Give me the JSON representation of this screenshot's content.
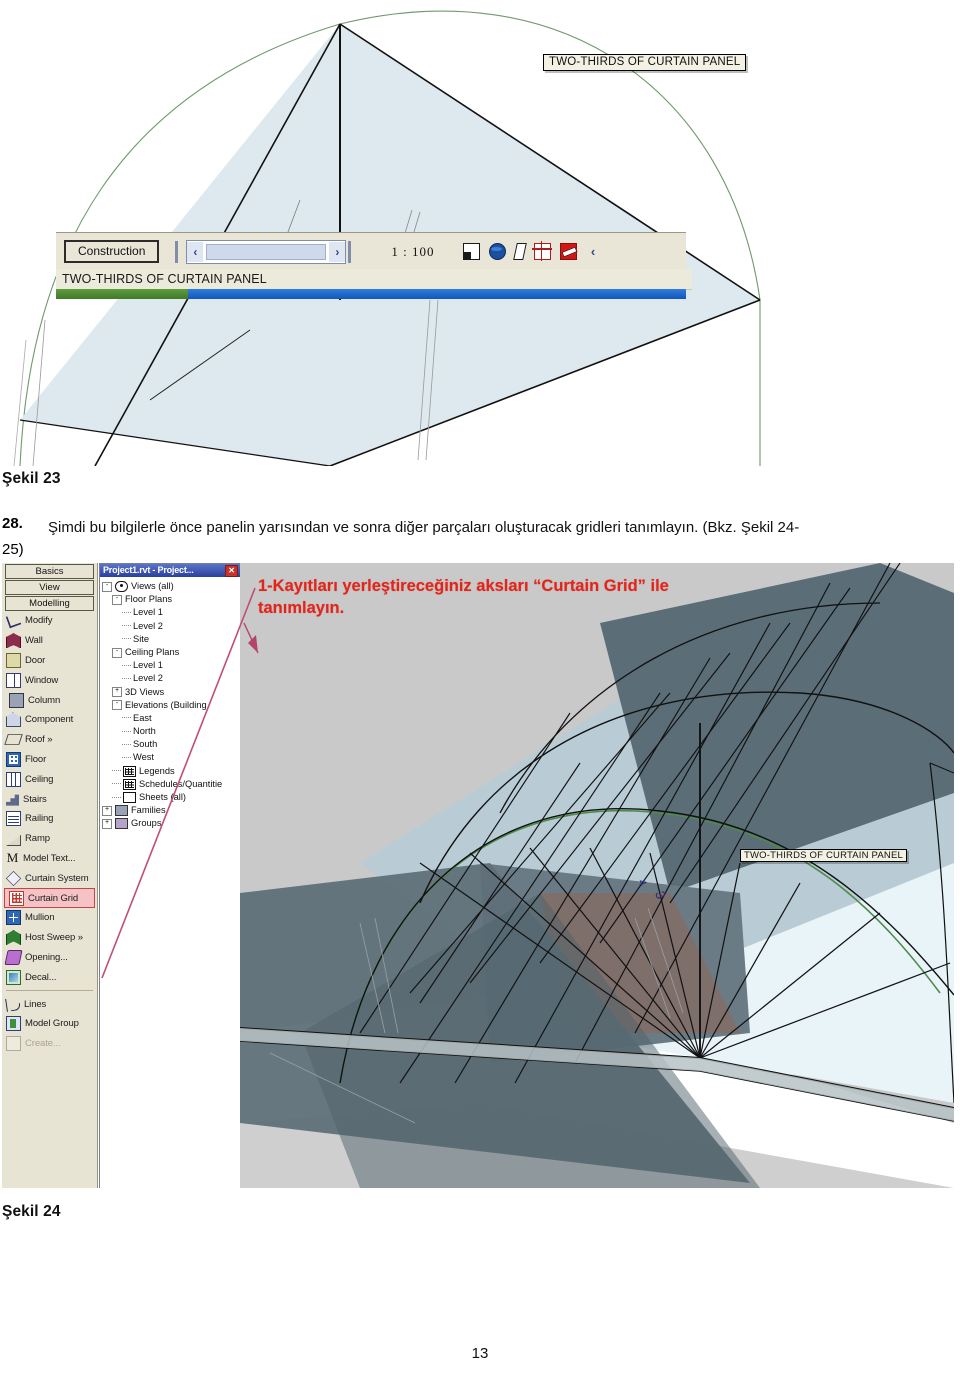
{
  "document": {
    "page_number": "13",
    "figure_23_caption": "Şekil 23",
    "figure_24_caption": "Şekil 24",
    "step": {
      "number": "28.",
      "text": "Şimdi bu bilgilerle önce panelin yarısından ve sonra diğer parçaları oluşturacak gridleri tanımlayın. (Bkz. Şekil 24-",
      "continuation": "25)"
    }
  },
  "figure23": {
    "panel_label": "TWO-THIRDS OF CURTAIN PANEL",
    "statusbar": {
      "phase_button": "Construction",
      "scale": "1 : 100",
      "prev_arrow": "‹",
      "next_arrow": "›",
      "icons": [
        {
          "name": "shadows-icon",
          "glyph": "shadow"
        },
        {
          "name": "render-globe-icon",
          "glyph": "globe"
        },
        {
          "name": "shading-icon",
          "glyph": "para"
        },
        {
          "name": "crop-region-icon",
          "glyph": "crop"
        },
        {
          "name": "hide-crop-icon",
          "glyph": "hide"
        },
        {
          "name": "collapse-left-icon",
          "glyph": "left"
        }
      ]
    },
    "view_name": "TWO-THIRDS OF CURTAIN PANEL"
  },
  "figure24": {
    "annotation": "1-Kayıtları yerleştireceğiniz aksları “Curtain Grid” ile tanımlayın.",
    "panel_label": "TWO-THIRDS OF CURTAIN PANEL",
    "designbar": {
      "tabs": [
        "Basics",
        "View",
        "Modelling"
      ],
      "tools": [
        {
          "label": "Modify",
          "icon": "modify-arrow-icon",
          "glyph": "g-modify",
          "selected": false,
          "disabled": false
        },
        {
          "label": "Wall",
          "icon": "wall-icon",
          "glyph": "g-wall",
          "selected": false,
          "disabled": false
        },
        {
          "label": "Door",
          "icon": "door-icon",
          "glyph": "g-door",
          "selected": false,
          "disabled": false
        },
        {
          "label": "Window",
          "icon": "window-icon",
          "glyph": "g-window",
          "selected": false,
          "disabled": false
        },
        {
          "label": "Column",
          "icon": "column-icon",
          "glyph": "g-column",
          "selected": false,
          "disabled": false
        },
        {
          "label": "Component",
          "icon": "component-icon",
          "glyph": "g-component",
          "selected": false,
          "disabled": false
        },
        {
          "label": "Roof »",
          "icon": "roof-icon",
          "glyph": "g-roof",
          "selected": false,
          "disabled": false
        },
        {
          "label": "Floor",
          "icon": "floor-icon",
          "glyph": "g-floor",
          "selected": false,
          "disabled": false
        },
        {
          "label": "Ceiling",
          "icon": "ceiling-icon",
          "glyph": "g-ceiling",
          "selected": false,
          "disabled": false
        },
        {
          "label": "Stairs",
          "icon": "stairs-icon",
          "glyph": "g-stairs",
          "selected": false,
          "disabled": false
        },
        {
          "label": "Railing",
          "icon": "railing-icon",
          "glyph": "g-railing",
          "selected": false,
          "disabled": false
        },
        {
          "label": "Ramp",
          "icon": "ramp-icon",
          "glyph": "g-ramp",
          "selected": false,
          "disabled": false
        },
        {
          "label": "Model Text...",
          "icon": "model-text-icon",
          "glyph": "g-mtext",
          "selected": false,
          "disabled": false
        },
        {
          "label": "Curtain System",
          "icon": "curtain-system-icon",
          "glyph": "g-csys",
          "selected": false,
          "disabled": false
        },
        {
          "label": "Curtain Grid",
          "icon": "curtain-grid-icon",
          "glyph": "g-cgrid",
          "selected": true,
          "disabled": false
        },
        {
          "label": "Mullion",
          "icon": "mullion-icon",
          "glyph": "g-mullion",
          "selected": false,
          "disabled": false
        },
        {
          "label": "Host Sweep »",
          "icon": "host-sweep-icon",
          "glyph": "g-hsweep",
          "selected": false,
          "disabled": false
        },
        {
          "label": "Opening...",
          "icon": "opening-icon",
          "glyph": "g-opening",
          "selected": false,
          "disabled": false
        },
        {
          "label": "Decal...",
          "icon": "decal-icon",
          "glyph": "g-decal",
          "selected": false,
          "disabled": false
        }
      ],
      "tools_bottom": [
        {
          "label": "Lines",
          "icon": "lines-icon",
          "glyph": "g-lines",
          "selected": false,
          "disabled": false
        },
        {
          "label": "Model Group",
          "icon": "model-group-icon",
          "glyph": "g-mgroup",
          "selected": false,
          "disabled": false
        },
        {
          "label": "Create...",
          "icon": "create-icon",
          "glyph": "g-create",
          "selected": false,
          "disabled": true
        }
      ]
    },
    "browser": {
      "title": "Project1.rvt - Project...",
      "close_label": "✕",
      "tree": [
        {
          "label": "Views (all)",
          "indent": 0,
          "box": "-",
          "icon": "eye-icon"
        },
        {
          "label": "Floor Plans",
          "indent": 1,
          "box": "-",
          "icon": ""
        },
        {
          "label": "Level 1",
          "indent": 2,
          "box": "",
          "icon": ""
        },
        {
          "label": "Level 2",
          "indent": 2,
          "box": "",
          "icon": ""
        },
        {
          "label": "Site",
          "indent": 2,
          "box": "",
          "icon": ""
        },
        {
          "label": "Ceiling Plans",
          "indent": 1,
          "box": "-",
          "icon": ""
        },
        {
          "label": "Level 1",
          "indent": 2,
          "box": "",
          "icon": ""
        },
        {
          "label": "Level 2",
          "indent": 2,
          "box": "",
          "icon": ""
        },
        {
          "label": "3D Views",
          "indent": 1,
          "box": "+",
          "icon": ""
        },
        {
          "label": "Elevations (Building",
          "indent": 1,
          "box": "-",
          "icon": ""
        },
        {
          "label": "East",
          "indent": 2,
          "box": "",
          "icon": ""
        },
        {
          "label": "North",
          "indent": 2,
          "box": "",
          "icon": ""
        },
        {
          "label": "South",
          "indent": 2,
          "box": "",
          "icon": ""
        },
        {
          "label": "West",
          "indent": 2,
          "box": "",
          "icon": ""
        },
        {
          "label": "Legends",
          "indent": 1,
          "box": "",
          "icon": "grid-icon"
        },
        {
          "label": "Schedules/Quantitie",
          "indent": 1,
          "box": "",
          "icon": "grid-icon"
        },
        {
          "label": "Sheets (all)",
          "indent": 1,
          "box": "",
          "icon": "sheet-icon"
        },
        {
          "label": "Families",
          "indent": 0,
          "box": "+",
          "icon": "family-icon"
        },
        {
          "label": "Groups",
          "indent": 0,
          "box": "+",
          "icon": "group-icon"
        }
      ]
    }
  },
  "colors": {
    "annotation_red": "#e1251b",
    "selection_pink": "#f5c2c6",
    "designbar_bg": "#e8e4d4",
    "browser_title": "#2a3f9e",
    "viewport_bg": "#c9c9c9",
    "panel_fill": "#dde9ee",
    "taskbar_blue": "#1157b8",
    "taskbar_green": "#4d8a33"
  }
}
